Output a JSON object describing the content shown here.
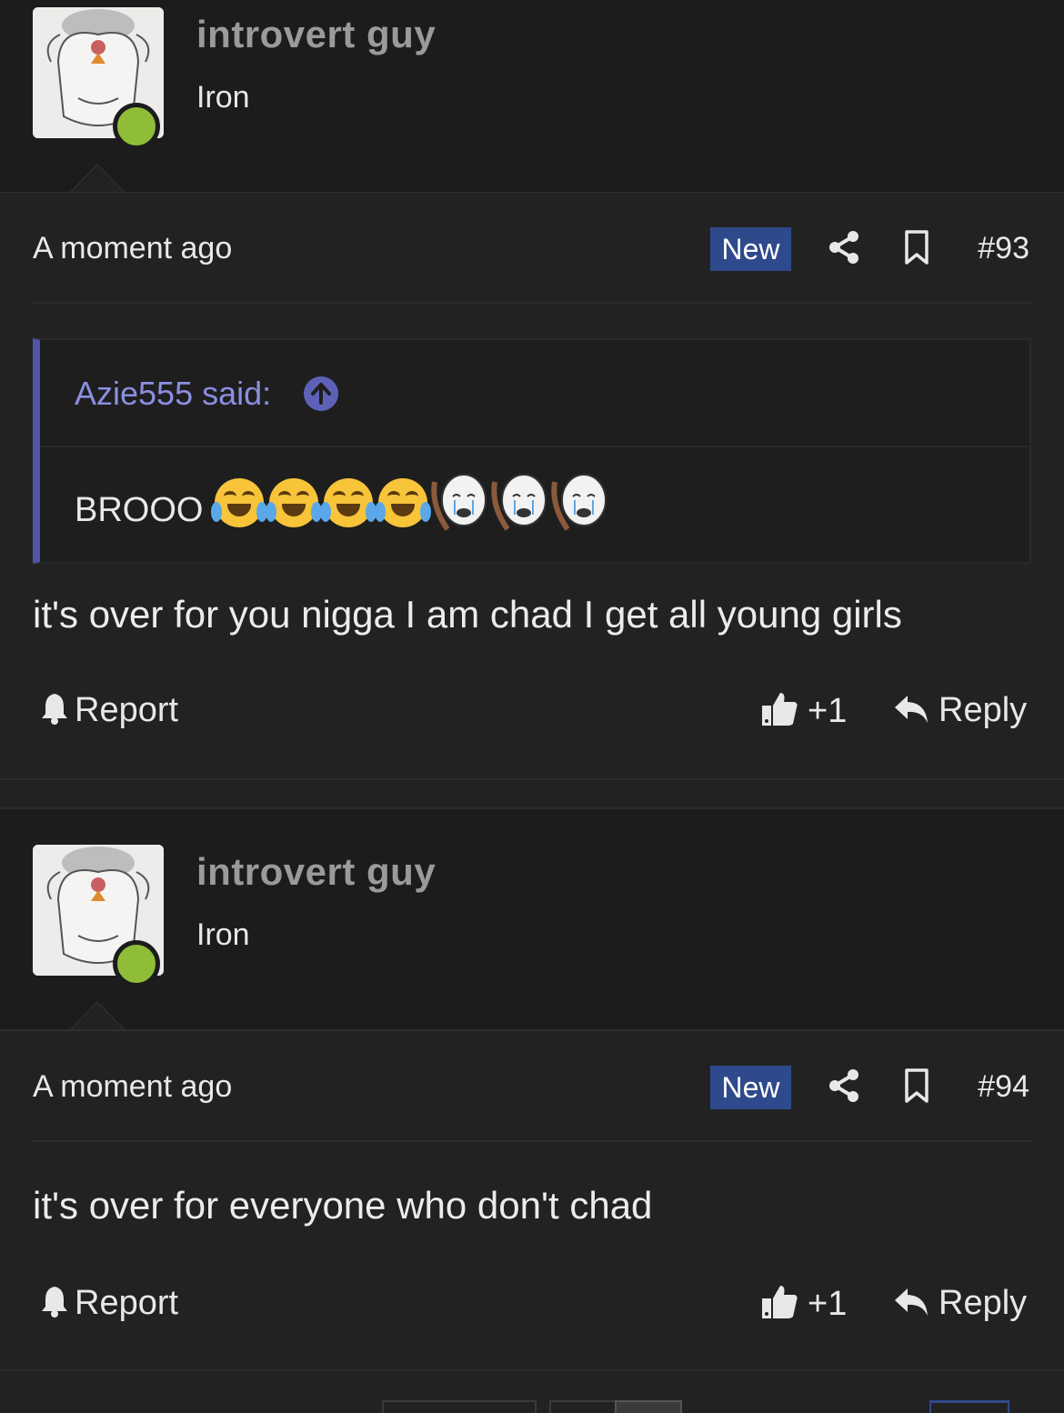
{
  "posts": [
    {
      "username": "introvert guy",
      "user_title": "Iron",
      "timestamp": "A moment ago",
      "badge": "New",
      "post_number": "#93",
      "quote": {
        "author": "Azie555 said:",
        "text": "BROOO",
        "emojis": [
          "joy-emoji",
          "joy-emoji",
          "joy-emoji",
          "joy-emoji",
          "crying-face-emoji",
          "crying-face-emoji",
          "crying-face-emoji"
        ]
      },
      "message": "it's over for you nigga I am chad I get all young girls",
      "report_label": "Report",
      "like_count": "+1",
      "reply_label": "Reply"
    },
    {
      "username": "introvert guy",
      "user_title": "Iron",
      "timestamp": "A moment ago",
      "badge": "New",
      "post_number": "#94",
      "message": "it's over for everyone who don't chad",
      "report_label": "Report",
      "like_count": "+1",
      "reply_label": "Reply"
    }
  ],
  "colors": {
    "background": "#222223",
    "header_background": "#1c1c1d",
    "online_indicator": "#8fbd37",
    "new_badge": "#2f4a8c",
    "quote_accent": "#5254a8",
    "quote_author": "#8a8fe0"
  }
}
